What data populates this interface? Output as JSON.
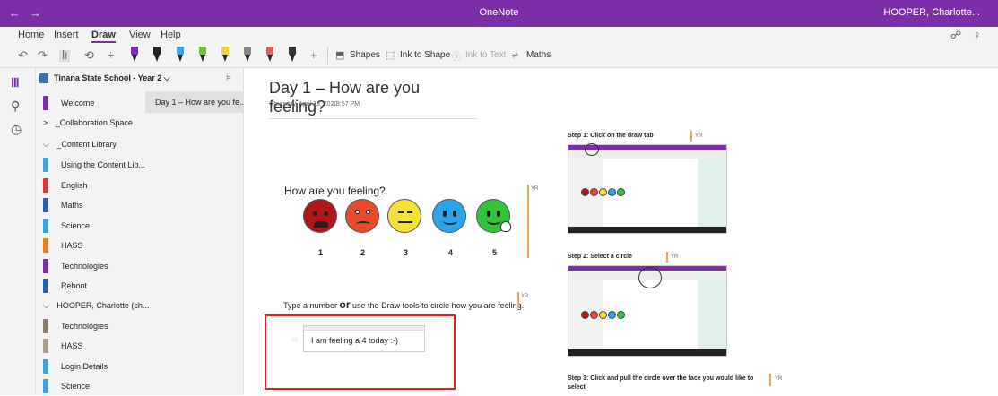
{
  "titlebar": {
    "back": "←",
    "forward": "→",
    "app_title": "OneNote",
    "user": "HOOPER, Charlotte..."
  },
  "ribbon": {
    "tabs": [
      {
        "label": "Home",
        "active": false
      },
      {
        "label": "Insert",
        "active": false
      },
      {
        "label": "Draw",
        "active": true
      },
      {
        "label": "View",
        "active": false
      },
      {
        "label": "Help",
        "active": false
      }
    ]
  },
  "toolbar": {
    "undo": "↶",
    "redo": "↷",
    "add_pen": "+",
    "shapes": "Shapes",
    "ink_to_shape": "Ink to Shape",
    "ink_to_text": "Ink to Text",
    "maths": "Maths",
    "pen_colors": [
      "#7b2fa8",
      "#222222",
      "#3ba3e0",
      "#6ac43a",
      "#f4d03f",
      "#888888",
      "#e06060",
      "#333333"
    ]
  },
  "notebook": {
    "name": "Tinana State School - Year 2",
    "chevron": "⌵"
  },
  "sections": [
    {
      "label": "Welcome",
      "color": "#7b2fa8"
    },
    {
      "label": "_Collaboration Space",
      "group": true,
      "chevron": ">"
    },
    {
      "label": "_Content Library",
      "group": true,
      "chevron": "⌵"
    },
    {
      "label": "Using the Content Lib...",
      "color": "#3ba3e0"
    },
    {
      "label": "English",
      "color": "#d43a3a"
    },
    {
      "label": "Maths",
      "color": "#2a5faa"
    },
    {
      "label": "Science",
      "color": "#3ba3e0"
    },
    {
      "label": "HASS",
      "color": "#f07a22"
    },
    {
      "label": "Technologies",
      "color": "#7b2fa8"
    },
    {
      "label": "Reboot",
      "color": "#2a5faa"
    },
    {
      "label": "HOOPER, Charlotte (ch...",
      "group": true,
      "chevron": "⌵"
    },
    {
      "label": "Technologies",
      "color": "#8a7f6a"
    },
    {
      "label": "HASS",
      "color": "#a89f8f"
    },
    {
      "label": "Login Details",
      "color": "#3ba3e0"
    },
    {
      "label": "Science",
      "color": "#3ba3e0"
    }
  ],
  "pages": [
    {
      "label": "Day 1 – How are you fe..."
    }
  ],
  "page": {
    "title": "Day 1 – How are you feeling?",
    "date": "Thursday, April 16, 2020",
    "time": "3:57 PM",
    "question": "How are you feeling?",
    "faces": [
      {
        "number": "1",
        "color": "#b01818"
      },
      {
        "number": "2",
        "color": "#e84a2a"
      },
      {
        "number": "3",
        "color": "#f5e03a"
      },
      {
        "number": "4",
        "color": "#2aa6e8"
      },
      {
        "number": "5",
        "color": "#34c23a"
      }
    ],
    "instruction_pre": "Type a number ",
    "instruction_or": "or",
    "instruction_post": " use the Draw tools to circle how you are feeling.",
    "answer": "I am feeling a 4 today :-)",
    "author_tag": "YR",
    "steps": [
      "Step 1: Click on the draw tab",
      "Step 2: Select a circle",
      "Step 3: Click and pull the circle over the face you would like to",
      "select"
    ]
  },
  "accent_color": "#7a2fa8",
  "highlight_color": "#e02020"
}
